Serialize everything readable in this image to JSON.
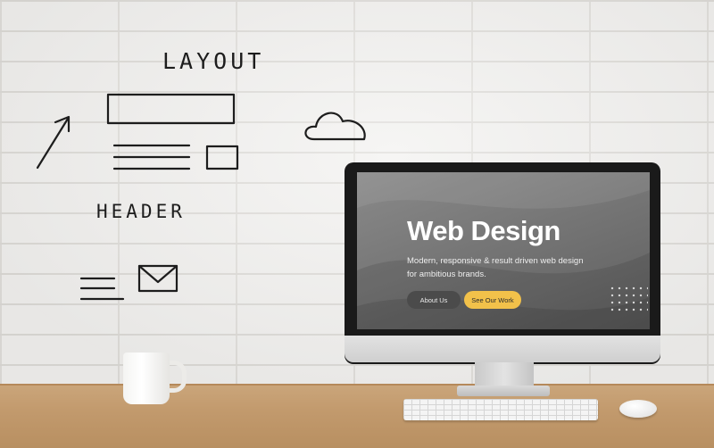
{
  "wall_sketch": {
    "layout_label": "LAYOUT",
    "header_label": "HEADER",
    "icons": [
      "arrow-icon",
      "cloud-icon",
      "envelope-icon",
      "menu-lines-icon"
    ]
  },
  "screen": {
    "title": "Web Design",
    "subtitle": "Modern, responsive & result driven web design for ambitious brands.",
    "buttons": {
      "about": "About Us",
      "work": "See Our Work"
    }
  },
  "colors": {
    "accent_button": "#f2c14a",
    "dark_button": "#4b4b4b",
    "desk": "#c29a6d",
    "wall": "#f1f0ee"
  }
}
